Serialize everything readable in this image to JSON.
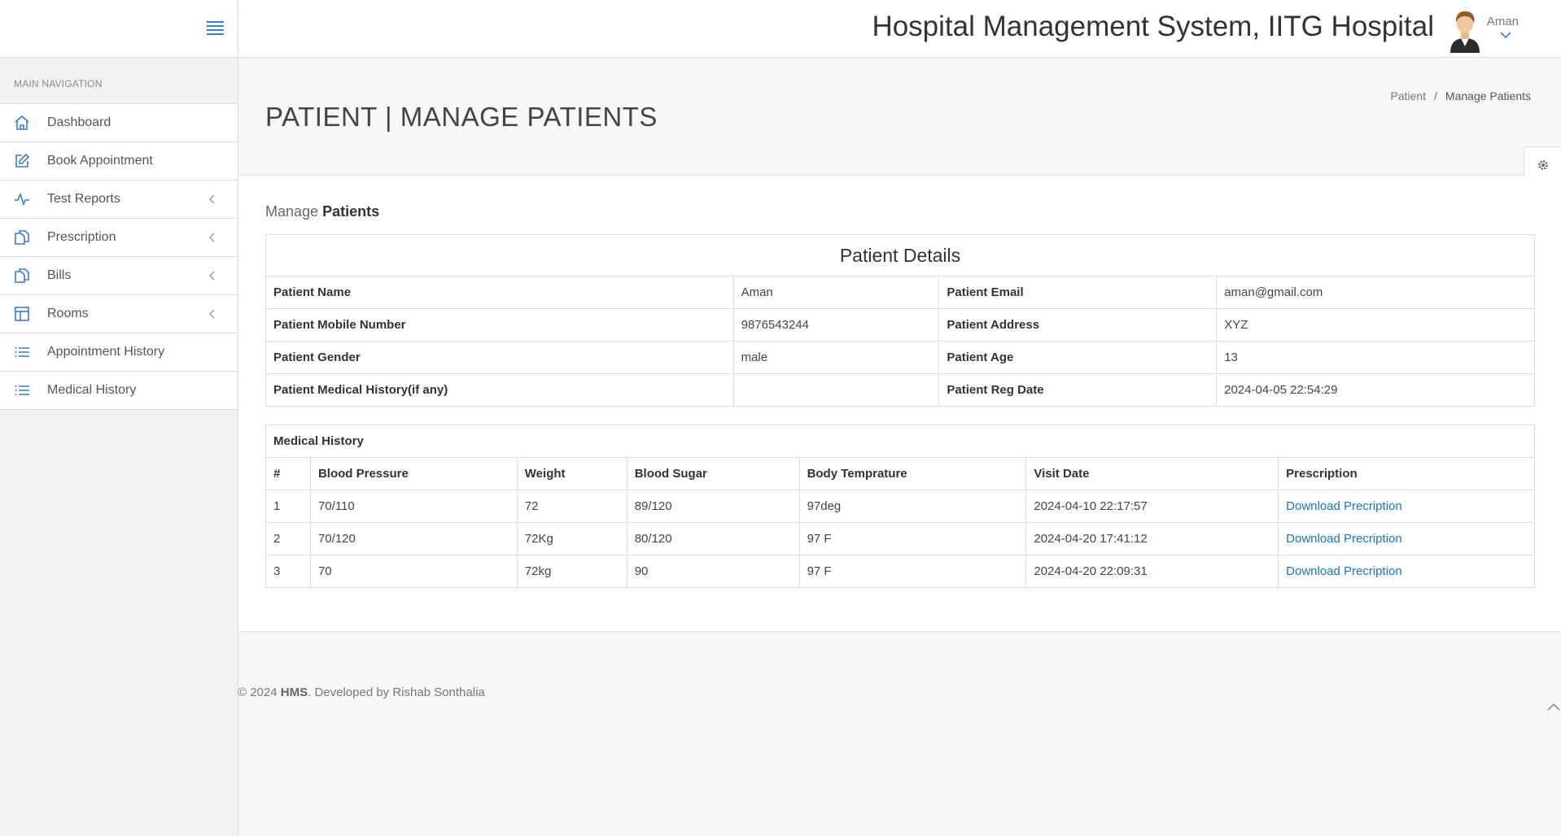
{
  "header": {
    "app_title": "Hospital Management System, IITG Hospital",
    "user_name": "Aman"
  },
  "sidebar": {
    "nav_title": "MAIN NAVIGATION",
    "items": [
      {
        "label": "Dashboard",
        "icon": "home-icon",
        "has_submenu": false
      },
      {
        "label": "Book Appointment",
        "icon": "edit-icon",
        "has_submenu": false
      },
      {
        "label": "Test Reports",
        "icon": "pulse-icon",
        "has_submenu": true
      },
      {
        "label": "Prescription",
        "icon": "files-icon",
        "has_submenu": true
      },
      {
        "label": "Bills",
        "icon": "files-icon",
        "has_submenu": true
      },
      {
        "label": "Rooms",
        "icon": "layout-icon",
        "has_submenu": true
      },
      {
        "label": "Appointment History",
        "icon": "list-icon",
        "has_submenu": false
      },
      {
        "label": "Medical History",
        "icon": "list-icon",
        "has_submenu": false
      }
    ]
  },
  "page": {
    "title": "PATIENT | MANAGE PATIENTS",
    "breadcrumb": {
      "parent": "Patient",
      "sep": "/",
      "current": "Manage Patients"
    },
    "section_prefix": "Manage",
    "section_bold": "Patients"
  },
  "patient_details": {
    "caption": "Patient Details",
    "rows": [
      {
        "k1": "Patient Name",
        "v1": "Aman",
        "k2": "Patient Email",
        "v2": "aman@gmail.com"
      },
      {
        "k1": "Patient Mobile Number",
        "v1": "9876543244",
        "k2": "Patient Address",
        "v2": "XYZ"
      },
      {
        "k1": "Patient Gender",
        "v1": "male",
        "k2": "Patient Age",
        "v2": "13"
      },
      {
        "k1": "Patient Medical History(if any)",
        "v1": "",
        "k2": "Patient Reg Date",
        "v2": "2024-04-05 22:54:29"
      }
    ]
  },
  "medical_history": {
    "caption": "Medical History",
    "headers": [
      "#",
      "Blood Pressure",
      "Weight",
      "Blood Sugar",
      "Body Temprature",
      "Visit Date",
      "Prescription"
    ],
    "rows": [
      [
        "1",
        "70/110",
        "72",
        "89/120",
        "97deg",
        "2024-04-10 22:17:57",
        "Download Precription"
      ],
      [
        "2",
        "70/120",
        "72Kg",
        "80/120",
        "97 F",
        "2024-04-20 17:41:12",
        "Download Precription"
      ],
      [
        "3",
        "70",
        "72kg",
        "90",
        "97 F",
        "2024-04-20 22:09:31",
        "Download Precription"
      ]
    ]
  },
  "footer": {
    "copyright": "© 2024 ",
    "brand": "HMS",
    "developer": ". Developed by Rishab Sonthalia"
  },
  "colors": {
    "accent": "#3a7bd5",
    "link": "#1a73c9",
    "sidebar_bg": "#f1f1f2"
  }
}
